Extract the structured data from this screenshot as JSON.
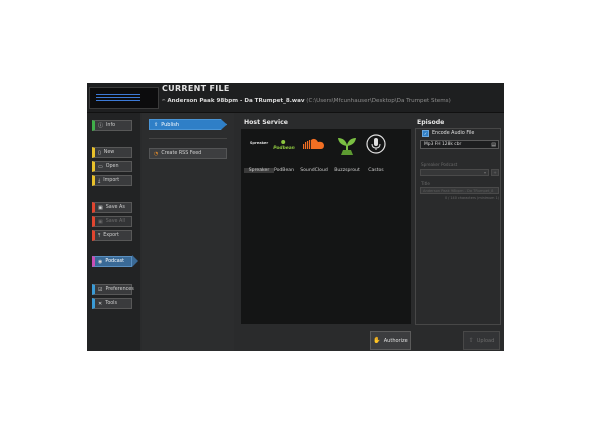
{
  "header": {
    "title": "CURRENT FILE",
    "file_name": "Anderson Paak 98bpm - Da TRumpet_8.wav",
    "file_path": "(C:\\Users\\Mfcunhauser\\Desktop\\Da Trumpet Stems)"
  },
  "sidebar": {
    "items": [
      {
        "label": "Info",
        "icon": "info-icon",
        "accent": "#3fae49",
        "enabled": true
      },
      {
        "label": "New",
        "icon": "new-file-icon",
        "accent": "#e8c02a",
        "enabled": true
      },
      {
        "label": "Open",
        "icon": "open-folder-icon",
        "accent": "#e8c02a",
        "enabled": true
      },
      {
        "label": "Import",
        "icon": "import-icon",
        "accent": "#e8c02a",
        "enabled": true
      },
      {
        "label": "Save As",
        "icon": "save-as-icon",
        "accent": "#e0452f",
        "enabled": true
      },
      {
        "label": "Save All",
        "icon": "save-all-icon",
        "accent": "#e0452f",
        "enabled": false
      },
      {
        "label": "Export",
        "icon": "export-icon",
        "accent": "#e0452f",
        "enabled": true
      },
      {
        "label": "Podcast",
        "icon": "podcast-icon",
        "accent": "#c94fb5",
        "enabled": true,
        "active": true
      },
      {
        "label": "Preferences",
        "icon": "preferences-icon",
        "accent": "#3a9bd6",
        "enabled": true
      },
      {
        "label": "Tools",
        "icon": "tools-icon",
        "accent": "#3a9bd6",
        "enabled": true
      }
    ]
  },
  "publish_panel": {
    "publish_label": "Publish",
    "rss_label": "Create RSS Feed"
  },
  "host_service": {
    "title": "Host Service",
    "services": [
      {
        "label": "Spreaker",
        "logo_text": "Spreaker",
        "selected": true
      },
      {
        "label": "PodBean",
        "logo_text": "Podbean"
      },
      {
        "label": "SoundCloud"
      },
      {
        "label": "Buzzsprout"
      },
      {
        "label": "Castos"
      }
    ],
    "authorize_label": "Authorize"
  },
  "episode": {
    "title": "Episode",
    "encode_label": "Encode Audio File",
    "encode_checked": true,
    "format_value": "Mp3 FH 128k cbr",
    "spreaker_podcast_label": "Spreaker Podcast",
    "title_label": "Title",
    "title_value": "Anderson Paak 98bpm - Da TRumpet_8",
    "title_count": "0 / 140 characters (minimum 1)",
    "upload_label": "Upload"
  },
  "colors": {
    "accent_blue": "#2f7fc7",
    "soundcloud_orange": "#f26f23",
    "buzzsprout_green": "#7bc043",
    "podbean_green": "#8cc63f"
  }
}
